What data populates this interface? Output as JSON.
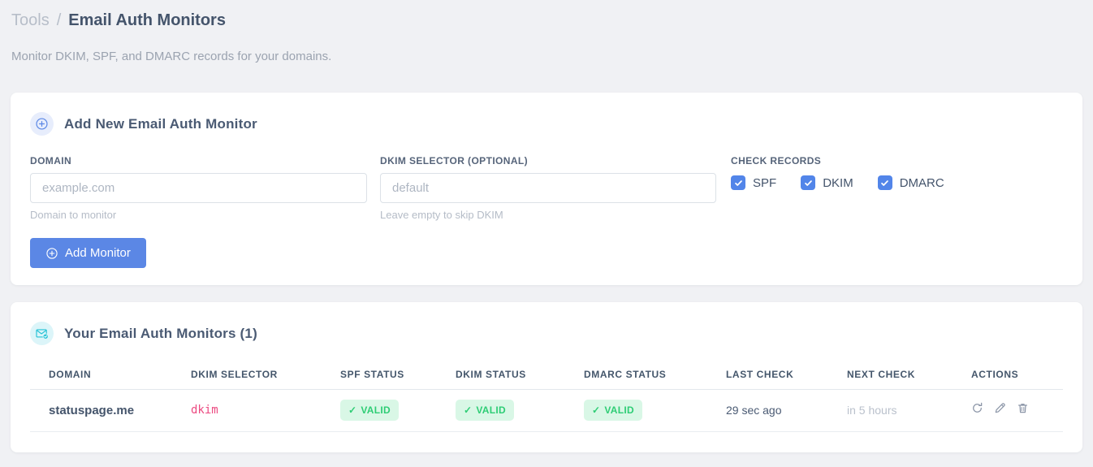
{
  "header": {
    "breadcrumb_parent": "Tools",
    "breadcrumb_separator": "/",
    "title": "Email Auth Monitors",
    "subtitle": "Monitor DKIM, SPF, and DMARC records for your domains."
  },
  "add_card": {
    "title": "Add New Email Auth Monitor",
    "domain_field": {
      "label": "DOMAIN",
      "placeholder": "example.com",
      "value": "",
      "hint": "Domain to monitor"
    },
    "dkim_field": {
      "label": "DKIM SELECTOR (OPTIONAL)",
      "placeholder": "default",
      "value": "",
      "hint": "Leave empty to skip DKIM"
    },
    "check_records": {
      "label": "CHECK RECORDS",
      "options": [
        {
          "label": "SPF",
          "checked": true
        },
        {
          "label": "DKIM",
          "checked": true
        },
        {
          "label": "DMARC",
          "checked": true
        }
      ]
    },
    "submit_button": "Add Monitor"
  },
  "monitors_card": {
    "title": "Your Email Auth Monitors (1)",
    "table": {
      "headers": [
        "DOMAIN",
        "DKIM SELECTOR",
        "SPF STATUS",
        "DKIM STATUS",
        "DMARC STATUS",
        "LAST CHECK",
        "NEXT CHECK",
        "ACTIONS"
      ],
      "valid_glyph": "✓",
      "rows": [
        {
          "domain": "statuspage.me",
          "dkim_selector": "dkim",
          "spf_status": "VALID",
          "dkim_status": "VALID",
          "dmarc_status": "VALID",
          "last_check": "29 sec ago",
          "next_check": "in 5 hours"
        }
      ]
    }
  },
  "colors": {
    "accent_blue": "#5b87e5",
    "checkbox_blue": "#5285e9",
    "badge_green_bg": "#d9f7e6",
    "badge_green_text": "#2ecd75",
    "code_pink": "#ec4a81",
    "icon_cyan": "#27c3d6",
    "page_background": "#f0f1f4"
  }
}
